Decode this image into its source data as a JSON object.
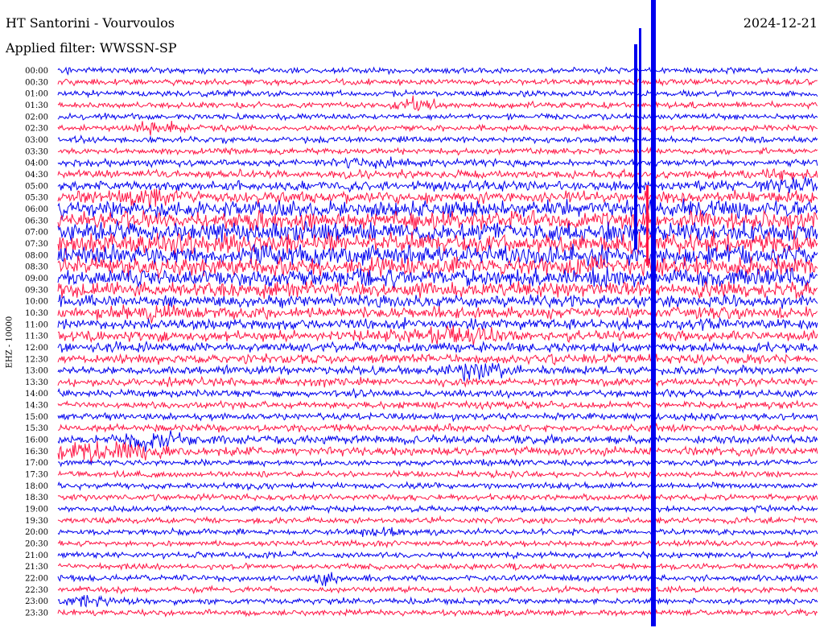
{
  "header": {
    "title": "HT Santorini - Vourvoulos",
    "date": "2024-12-21",
    "filter_label": "Applied filter: WWSSN-SP"
  },
  "chart_data": {
    "type": "heliplot",
    "channel_label": "EHZ - 10000",
    "row_labels": [
      "00:00",
      "00:30",
      "01:00",
      "01:30",
      "02:00",
      "02:30",
      "03:00",
      "03:30",
      "04:00",
      "04:30",
      "05:00",
      "05:30",
      "06:00",
      "06:30",
      "07:00",
      "07:30",
      "08:00",
      "08:30",
      "09:00",
      "09:30",
      "10:00",
      "10:30",
      "11:00",
      "11:30",
      "12:00",
      "12:30",
      "13:00",
      "13:30",
      "14:00",
      "14:30",
      "15:00",
      "15:30",
      "16:00",
      "16:30",
      "17:00",
      "17:30",
      "18:00",
      "18:30",
      "19:00",
      "19:30",
      "20:00",
      "20:30",
      "21:00",
      "21:30",
      "22:00",
      "22:30",
      "23:00",
      "23:30"
    ],
    "series_colors": [
      "#0000ee",
      "#ff1444"
    ],
    "grid": false
  }
}
